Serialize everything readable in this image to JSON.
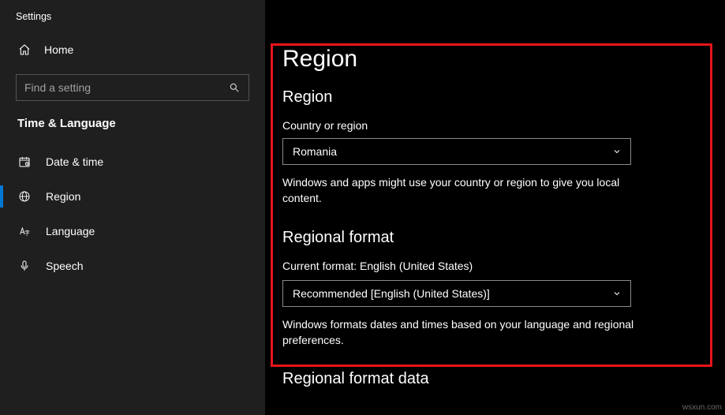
{
  "app_title": "Settings",
  "home_label": "Home",
  "search": {
    "placeholder": "Find a setting"
  },
  "section_label": "Time & Language",
  "nav": {
    "items": [
      {
        "id": "date-time",
        "label": "Date & time"
      },
      {
        "id": "region",
        "label": "Region"
      },
      {
        "id": "language",
        "label": "Language"
      },
      {
        "id": "speech",
        "label": "Speech"
      }
    ],
    "active": "region"
  },
  "page": {
    "title": "Region",
    "region": {
      "heading": "Region",
      "field_label": "Country or region",
      "value": "Romania",
      "hint": "Windows and apps might use your country or region to give you local content."
    },
    "format": {
      "heading": "Regional format",
      "current_prefix": "Current format: ",
      "current_value": "English (United States)",
      "select_value": "Recommended [English (United States)]",
      "hint": "Windows formats dates and times based on your language and regional preferences."
    },
    "format_data_heading": "Regional format data"
  },
  "watermark": "wsxun.com"
}
